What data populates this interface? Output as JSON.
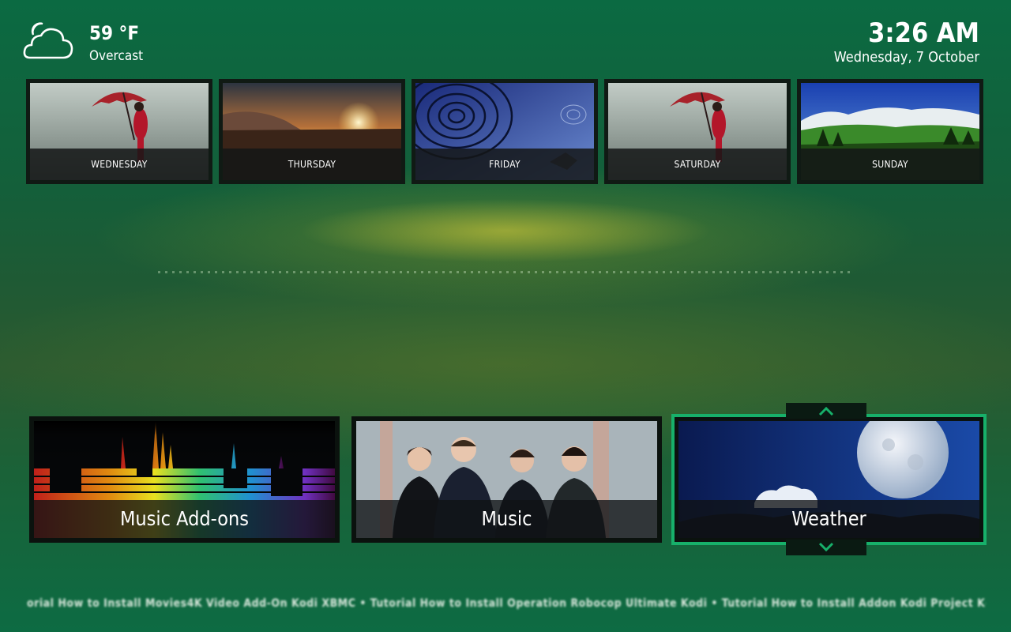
{
  "current_weather": {
    "icon": "cloud-icon",
    "temperature": "59 °F",
    "condition": "Overcast"
  },
  "clock": {
    "time": "3:26 AM",
    "date": "Wednesday, 7 October"
  },
  "forecast": [
    {
      "day": "WEDNESDAY",
      "art": "rain-umbrella"
    },
    {
      "day": "THURSDAY",
      "art": "sunset"
    },
    {
      "day": "FRIDAY",
      "art": "water-ripples"
    },
    {
      "day": "SATURDAY",
      "art": "rain-umbrella"
    },
    {
      "day": "SUNDAY",
      "art": "mountain-meadow"
    }
  ],
  "menu": [
    {
      "label": "Music Add-ons",
      "art": "equalizer",
      "focused": false
    },
    {
      "label": "Music",
      "art": "band-photo",
      "focused": false
    },
    {
      "label": "Weather",
      "art": "moon-sky",
      "focused": true
    }
  ],
  "ticker": {
    "text": "orial How to Install Movies4K Video Add-On Kodi XBMC • Tutorial How to Install Operation Robocop Ultimate Kodi • Tutorial How to Install Addon Kodi Project Kod"
  },
  "colors": {
    "background": "#0d6b43",
    "focus_outline": "#17b06a"
  }
}
